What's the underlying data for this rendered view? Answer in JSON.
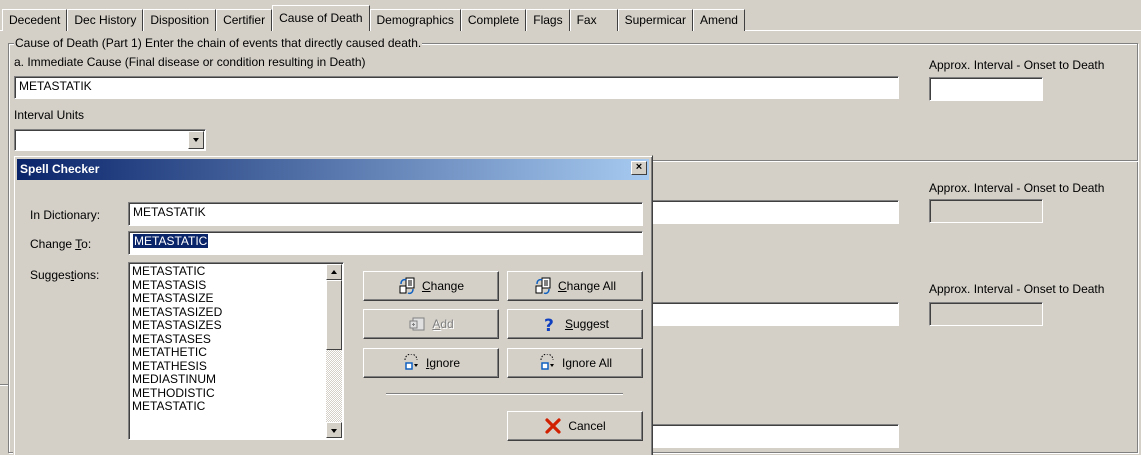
{
  "tabs": [
    "Decedent",
    "Dec History",
    "Disposition",
    "Certifier",
    "Cause of Death",
    "Demographics",
    "Complete",
    "Flags",
    "Fax",
    "Supermicar",
    "Amend"
  ],
  "active_tab": "Cause of Death",
  "form": {
    "group_title": "Cause of Death (Part 1) Enter the chain of events that directly caused death.",
    "immediate_cause_label": "a. Immediate Cause (Final disease or condition resulting in Death)",
    "immediate_cause_value": "METASTATIK",
    "interval_label": "Approx. Interval - Onset to Death",
    "interval_label_b": "Approx. Interval - Onset to Death",
    "interval_label_c": "Approx. Interval - Onset to Death",
    "interval_units_label": "Interval Units",
    "interval_units_value": ""
  },
  "dialog": {
    "title": "Spell Checker",
    "close_glyph": "×",
    "in_dictionary_label": "In Dictionary:",
    "in_dictionary_value": "METASTATIK",
    "change_to_label_pre": "Change ",
    "change_to_label_key": "T",
    "change_to_label_post": "o:",
    "change_to_value": "METASTATIC",
    "suggestions_label_pre": "Sugges",
    "suggestions_label_key": "t",
    "suggestions_label_post": "ions:",
    "suggestions": [
      "METASTATIC",
      "METASTASIS",
      "METASTASIZE",
      "METASTASIZED",
      "METASTASIZES",
      "METASTASES",
      "METATHETIC",
      "METATHESIS",
      "MEDIASTINUM",
      "METHODISTIC",
      "METASTATIC"
    ],
    "buttons": {
      "change": {
        "key": "C",
        "rest": "hange"
      },
      "change_all": {
        "key": "C",
        "rest": "hange All"
      },
      "add": {
        "key": "A",
        "rest": "dd"
      },
      "suggest": {
        "key": "S",
        "rest": "uggest"
      },
      "ignore": {
        "key": "I",
        "rest": "gnore"
      },
      "ignore_all": {
        "pre": "I",
        "key": "g",
        "rest": "nore All"
      },
      "cancel": "Cancel"
    }
  },
  "colors": {
    "title_start": "#0a246a",
    "title_end": "#a6caf0",
    "selection": "#0a246a",
    "cancel_icon": "#d02000"
  }
}
